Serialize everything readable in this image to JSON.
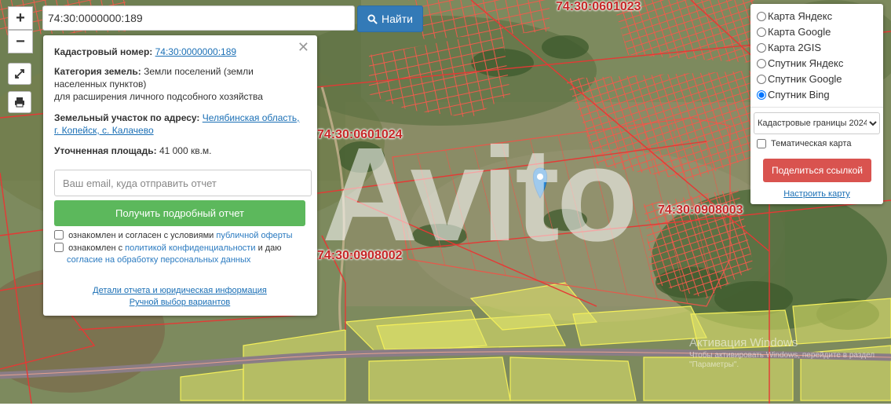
{
  "search": {
    "value": "74:30:0000000:189",
    "button_label": "Найти"
  },
  "zoom": {
    "in_label": "+",
    "out_label": "−"
  },
  "map_labels": [
    "74:30:0601023",
    "74:30:0601024",
    "74:30:0908003",
    "74:30:0908002"
  ],
  "info": {
    "cadastral_label": "Кадастровый номер:",
    "cadastral_number": "74:30:0000000:189",
    "category_label": "Категория земель:",
    "category_value": "Земли поселений (земли населенных пунктов)",
    "category_purpose": "для расширения личного подсобного хозяйства",
    "address_label": "Земельный участок по адресу:",
    "address_value": "Челябинская область, г. Копейск, с. Калачево",
    "area_label": "Уточненная площадь:",
    "area_value": "41 000 кв.м.",
    "email_placeholder": "Ваш email, куда отправить отчет",
    "report_button": "Получить подробный отчет",
    "consent1_text": "ознакомлен и согласен с условиями",
    "consent1_link": "публичной оферты",
    "consent2_text": "ознакомлен с",
    "consent2_link1": "политикой конфиденциальности",
    "consent2_mid": "и даю",
    "consent2_link2": "согласие на обработку персональных данных",
    "details_link": "Детали отчета и юридическая информация",
    "manual_link": "Ручной выбор вариантов"
  },
  "layers": {
    "options": [
      "Карта Яндекс",
      "Карта Google",
      "Карта 2GIS",
      "Спутник Яндекс",
      "Спутник Google",
      "Спутник Bing"
    ],
    "selected_index": 5,
    "select_value": "Кадастровые границы 2024",
    "thematic_label": "Тематическая карта",
    "share_button": "Поделиться ссылкой",
    "setup_link": "Настроить карту"
  },
  "watermarks": {
    "brand": "Avito",
    "windows_title": "Активация Windows",
    "windows_sub": "Чтобы активировать Windows, перейдите в раздел \"Параметры\"."
  },
  "colors": {
    "cadastral_line": "#e53935",
    "search_button": "#337ab7",
    "report_button": "#5cb85c",
    "share_button": "#d9534f",
    "marker": "#2b8ad8"
  }
}
